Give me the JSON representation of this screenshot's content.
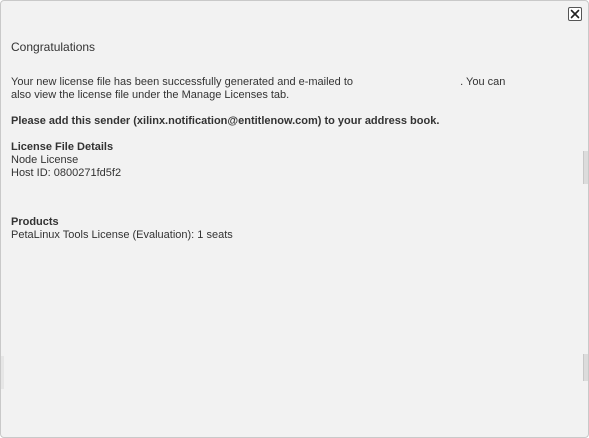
{
  "dialog": {
    "title": "Congratulations",
    "close_icon": "close-icon",
    "message_part1": "Your new license file has been successfully generated and e-mailed to",
    "message_part2": ". You can also view the license file under the Manage Licenses tab.",
    "notice": "Please add this sender (xilinx.notification@entitlenow.com) to your address book.",
    "details": {
      "heading": "License File Details",
      "license_type": "Node License",
      "host_id": "Host ID: 0800271fd5f2"
    },
    "products": {
      "heading": "Products",
      "items": [
        "PetaLinux Tools License (Evaluation): 1 seats"
      ]
    }
  }
}
